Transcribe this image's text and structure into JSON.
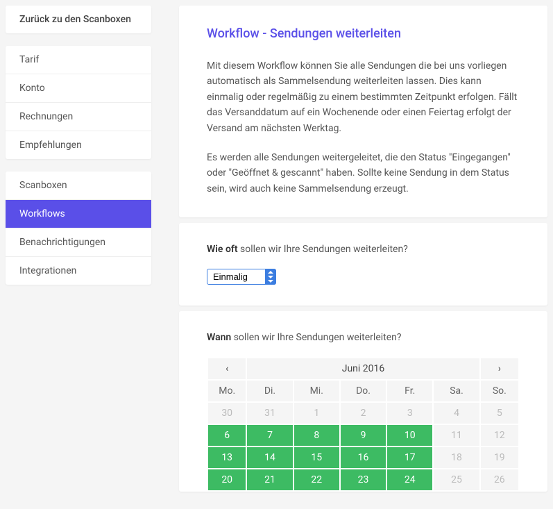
{
  "sidebar": {
    "back": "Zurück zu den Scanboxen",
    "group1": [
      "Tarif",
      "Konto",
      "Rechnungen",
      "Empfehlungen"
    ],
    "group2": [
      "Scanboxen",
      "Workflows",
      "Benachrichtigungen",
      "Integrationen"
    ],
    "active": "Workflows"
  },
  "intro": {
    "title": "Workflow - Sendungen weiterleiten",
    "p1": "Mit diesem Workflow können Sie alle Sendungen die bei uns vorliegen automatisch als Sammelsendung weiterleiten lassen.  Dies kann einmalig oder regelmäßig zu einem bestimmten Zeitpunkt erfolgen. Fällt das Versanddatum auf ein Wochenende oder einen Feiertag erfolgt der Versand am nächsten Werktag.",
    "p2": "Es werden alle Sendungen weitergeleitet, die den Status \"Eingegangen\" oder \"Geöffnet & gescannt\" haben. Sollte keine Sendung in dem Status sein, wird auch keine Sammelsendung erzeugt."
  },
  "freq": {
    "label_strong": "Wie oft",
    "label_rest": " sollen wir Ihre Sendungen weiterleiten?",
    "selected": "Einmalig",
    "options": [
      "Einmalig"
    ]
  },
  "when": {
    "label_strong": "Wann",
    "label_rest": " sollen wir Ihre Sendungen weiterleiten?"
  },
  "calendar": {
    "prev": "‹",
    "next": "›",
    "title": "Juni 2016",
    "dow": [
      "Mo.",
      "Di.",
      "Mi.",
      "Do.",
      "Fr.",
      "Sa.",
      "So."
    ],
    "rows": [
      [
        {
          "d": "30",
          "t": "other"
        },
        {
          "d": "31",
          "t": "other"
        },
        {
          "d": "1",
          "t": "disabled"
        },
        {
          "d": "2",
          "t": "disabled"
        },
        {
          "d": "3",
          "t": "disabled"
        },
        {
          "d": "4",
          "t": "disabled"
        },
        {
          "d": "5",
          "t": "disabled"
        }
      ],
      [
        {
          "d": "6",
          "t": "avail"
        },
        {
          "d": "7",
          "t": "avail"
        },
        {
          "d": "8",
          "t": "avail"
        },
        {
          "d": "9",
          "t": "avail"
        },
        {
          "d": "10",
          "t": "avail"
        },
        {
          "d": "11",
          "t": "disabled"
        },
        {
          "d": "12",
          "t": "disabled"
        }
      ],
      [
        {
          "d": "13",
          "t": "avail"
        },
        {
          "d": "14",
          "t": "avail"
        },
        {
          "d": "15",
          "t": "avail"
        },
        {
          "d": "16",
          "t": "avail"
        },
        {
          "d": "17",
          "t": "avail"
        },
        {
          "d": "18",
          "t": "disabled"
        },
        {
          "d": "19",
          "t": "disabled"
        }
      ],
      [
        {
          "d": "20",
          "t": "avail"
        },
        {
          "d": "21",
          "t": "avail"
        },
        {
          "d": "22",
          "t": "avail"
        },
        {
          "d": "23",
          "t": "avail"
        },
        {
          "d": "24",
          "t": "avail"
        },
        {
          "d": "25",
          "t": "disabled"
        },
        {
          "d": "26",
          "t": "disabled"
        }
      ]
    ]
  }
}
